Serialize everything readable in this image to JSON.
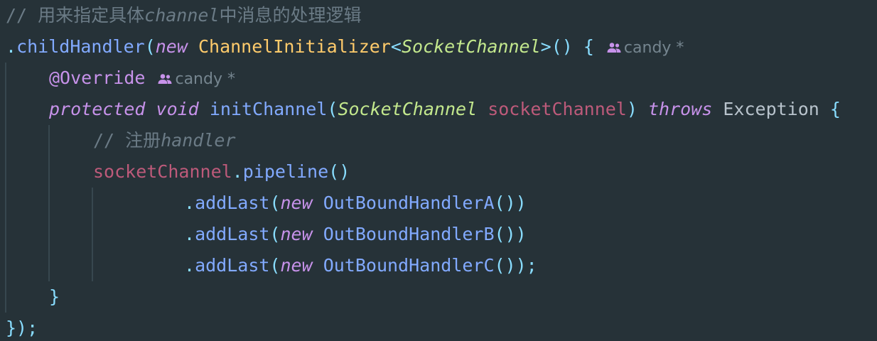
{
  "code": {
    "line1": {
      "comment": "// 用来指定具体",
      "comment_it": "channel",
      "comment_tail": "中消息的处理逻辑"
    },
    "line2": {
      "dot": ".",
      "method": "childHandler",
      "open": "(",
      "kw_new": "new",
      "class": "ChannelInitializer",
      "lt": "<",
      "type": "SocketChannel",
      "gt": ">",
      "call": "() {",
      "author": "candy *"
    },
    "line3": {
      "annotation": "@Override",
      "author": "candy *"
    },
    "line4": {
      "kw_protected": "protected",
      "kw_void": "void",
      "method": "initChannel",
      "open": "(",
      "type": "SocketChannel",
      "param": "socketChannel",
      "close": ")",
      "kw_throws": "throws",
      "exception": "Exception",
      "brace": "{"
    },
    "line5": {
      "comment": "// 注册",
      "comment_it": "handler"
    },
    "line6": {
      "var": "socketChannel",
      "dot": ".",
      "method": "pipeline",
      "parens": "()"
    },
    "line7": {
      "dot": ".",
      "method": "addLast",
      "open": "(",
      "kw_new": "new",
      "handler": "OutBoundHandlerA",
      "close": "())"
    },
    "line8": {
      "dot": ".",
      "method": "addLast",
      "open": "(",
      "kw_new": "new",
      "handler": "OutBoundHandlerB",
      "close": "())"
    },
    "line9": {
      "dot": ".",
      "method": "addLast",
      "open": "(",
      "kw_new": "new",
      "handler": "OutBoundHandlerC",
      "close": "());"
    },
    "line10": {
      "brace": "}"
    },
    "line11": {
      "close": "});"
    }
  },
  "icons": {
    "author": "people-icon"
  },
  "colors": {
    "background": "#263238",
    "comment": "#6b7b86",
    "method": "#82aaff",
    "keyword": "#c792ea",
    "class": "#ffcb6b",
    "type": "#c3e88d",
    "param": "#e06c75"
  }
}
